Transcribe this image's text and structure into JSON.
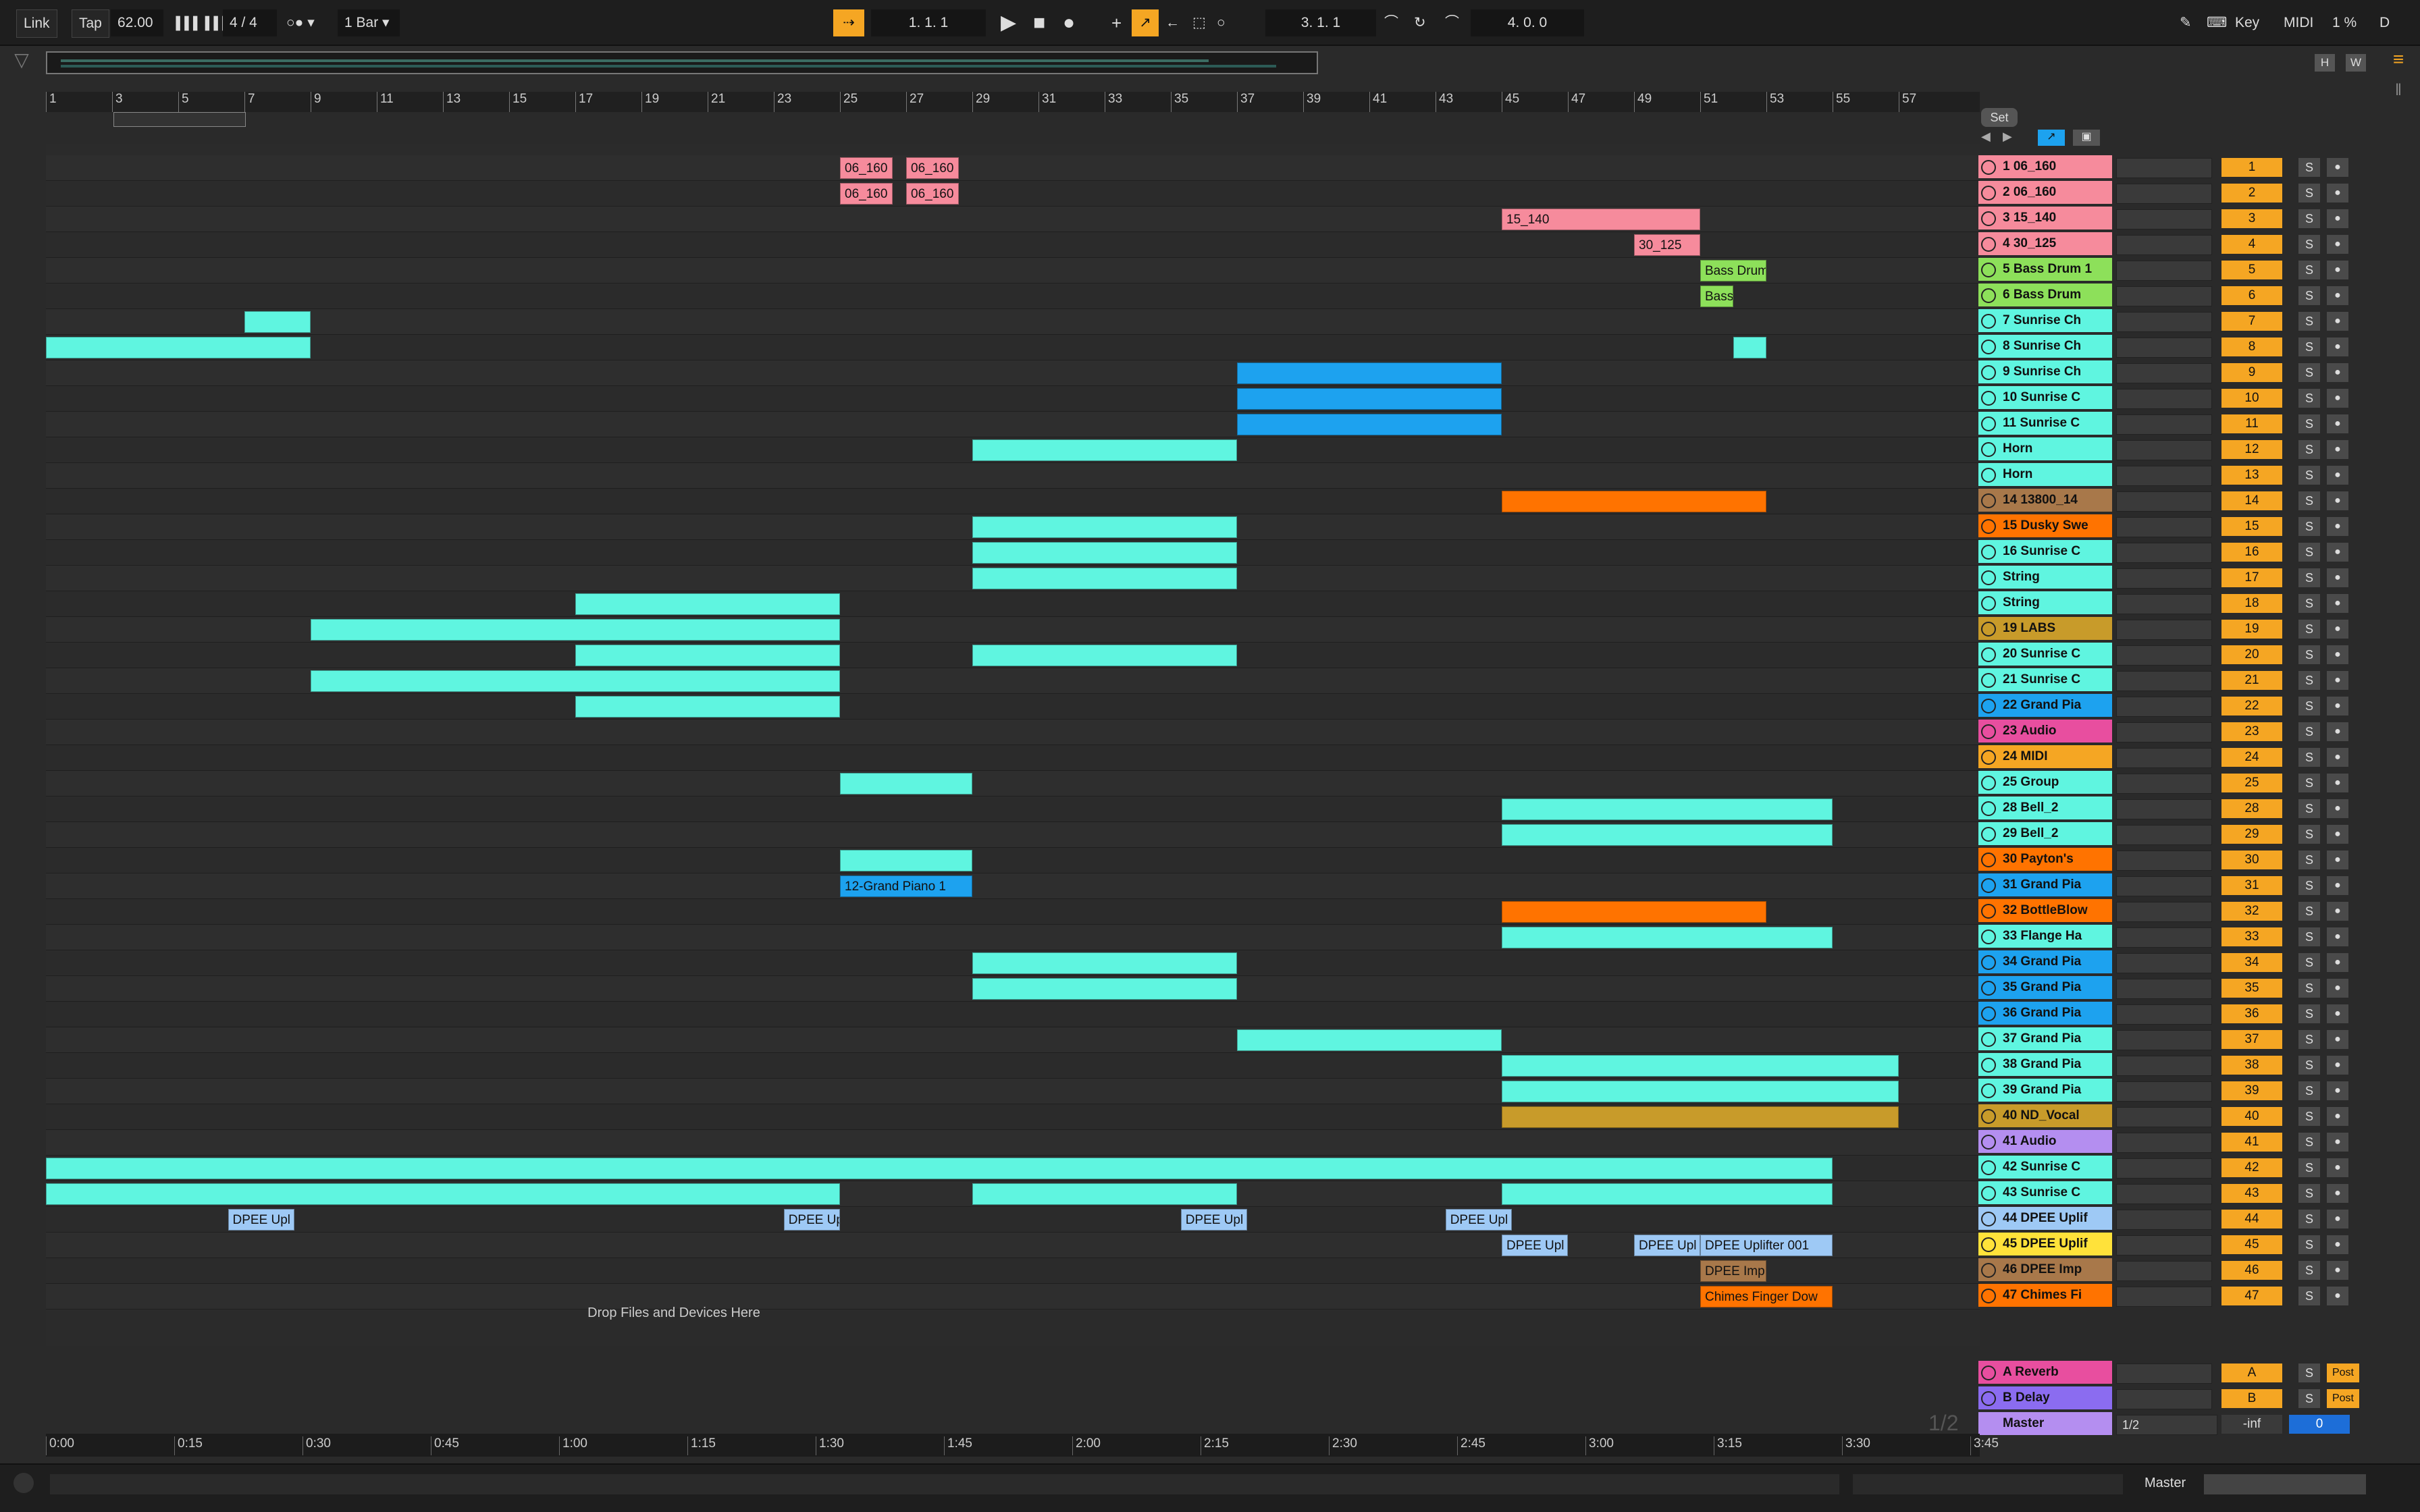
{
  "transport": {
    "link": "Link",
    "tap": "Tap",
    "tempo": "62.00",
    "signature": "4 / 4",
    "quantize": "1 Bar",
    "position": "1.   1.   1",
    "loop_start": "3.   1.   1",
    "loop_length": "4.   0.   0",
    "key": "Key",
    "midi": "MIDI",
    "cpu": "1 %",
    "disk": "D",
    "icons": [
      "metronome-icon",
      "play-icon",
      "stop-icon",
      "record-icon",
      "draw-mode-icon",
      "loop-icon",
      "pencil-icon"
    ]
  },
  "overview": {
    "h_button": "H",
    "w_button": "W"
  },
  "ruler": {
    "bars": [
      "1",
      "3",
      "5",
      "7",
      "9",
      "11",
      "13",
      "15",
      "17",
      "19",
      "21",
      "23",
      "25",
      "27",
      "29",
      "31",
      "33",
      "35",
      "37",
      "39",
      "41",
      "43",
      "45",
      "47",
      "49",
      "51",
      "53",
      "55",
      "57"
    ]
  },
  "set_button": "Set",
  "drop_text": "Drop Files and Devices Here",
  "page_counter": "1/2",
  "colors": {
    "pink": "#f68b9c",
    "green": "#8de05a",
    "cyan": "#5ff5e0",
    "blue": "#1da2ef",
    "orange": "#ff7300",
    "brown": "#a8784a",
    "gold": "#c89b2a",
    "magenta": "#e84e9f",
    "lightblue": "#9ec9f5",
    "yellow": "#ffe23a",
    "purple": "#b48ef0",
    "violet": "#8b6cf0",
    "accent": "#f5a623"
  },
  "tracks": [
    {
      "name": "1 06_160",
      "num": "1",
      "color": "pink"
    },
    {
      "name": "2 06_160",
      "num": "2",
      "color": "pink"
    },
    {
      "name": "3 15_140",
      "num": "3",
      "color": "pink"
    },
    {
      "name": "4 30_125",
      "num": "4",
      "color": "pink"
    },
    {
      "name": "5 Bass Drum 1",
      "num": "5",
      "color": "green"
    },
    {
      "name": "6 Bass Drum",
      "num": "6",
      "color": "green"
    },
    {
      "name": "7 Sunrise Ch",
      "num": "7",
      "color": "cyan"
    },
    {
      "name": "8 Sunrise Ch",
      "num": "8",
      "color": "cyan"
    },
    {
      "name": "9 Sunrise Ch",
      "num": "9",
      "color": "cyan"
    },
    {
      "name": "10 Sunrise C",
      "num": "10",
      "color": "cyan"
    },
    {
      "name": "11 Sunrise C",
      "num": "11",
      "color": "cyan"
    },
    {
      "name": "Horn",
      "num": "12",
      "color": "cyan"
    },
    {
      "name": "Horn",
      "num": "13",
      "color": "cyan"
    },
    {
      "name": "14 13800_14",
      "num": "14",
      "color": "brown"
    },
    {
      "name": "15 Dusky Swe",
      "num": "15",
      "color": "orange"
    },
    {
      "name": "16 Sunrise C",
      "num": "16",
      "color": "cyan"
    },
    {
      "name": "String",
      "num": "17",
      "color": "cyan"
    },
    {
      "name": "String",
      "num": "18",
      "color": "cyan"
    },
    {
      "name": "19 LABS",
      "num": "19",
      "color": "gold"
    },
    {
      "name": "20 Sunrise C",
      "num": "20",
      "color": "cyan"
    },
    {
      "name": "21 Sunrise C",
      "num": "21",
      "color": "cyan"
    },
    {
      "name": "22 Grand Pia",
      "num": "22",
      "color": "blue"
    },
    {
      "name": "23 Audio",
      "num": "23",
      "color": "magenta"
    },
    {
      "name": "24 MIDI",
      "num": "24",
      "color": "accent"
    },
    {
      "name": "25 Group",
      "num": "25",
      "color": "cyan"
    },
    {
      "name": "28 Bell_2",
      "num": "28",
      "color": "cyan"
    },
    {
      "name": "29 Bell_2",
      "num": "29",
      "color": "cyan"
    },
    {
      "name": "30 Payton's",
      "num": "30",
      "color": "orange"
    },
    {
      "name": "31 Grand Pia",
      "num": "31",
      "color": "blue"
    },
    {
      "name": "32 BottleBlow",
      "num": "32",
      "color": "orange"
    },
    {
      "name": "33 Flange Ha",
      "num": "33",
      "color": "cyan"
    },
    {
      "name": "34 Grand Pia",
      "num": "34",
      "color": "blue"
    },
    {
      "name": "35 Grand Pia",
      "num": "35",
      "color": "blue"
    },
    {
      "name": "36 Grand Pia",
      "num": "36",
      "color": "blue"
    },
    {
      "name": "37 Grand Pia",
      "num": "37",
      "color": "cyan"
    },
    {
      "name": "38 Grand Pia",
      "num": "38",
      "color": "cyan"
    },
    {
      "name": "39 Grand Pia",
      "num": "39",
      "color": "cyan"
    },
    {
      "name": "40 ND_Vocal",
      "num": "40",
      "color": "gold"
    },
    {
      "name": "41 Audio",
      "num": "41",
      "color": "purple"
    },
    {
      "name": "42 Sunrise C",
      "num": "42",
      "color": "cyan"
    },
    {
      "name": "43 Sunrise C",
      "num": "43",
      "color": "cyan"
    },
    {
      "name": "44 DPEE Uplif",
      "num": "44",
      "color": "lightblue"
    },
    {
      "name": "45 DPEE Uplif",
      "num": "45",
      "color": "yellow"
    },
    {
      "name": "46 DPEE Imp",
      "num": "46",
      "color": "brown"
    },
    {
      "name": "47 Chimes Fi",
      "num": "47",
      "color": "orange"
    }
  ],
  "returns": [
    {
      "name": "A Reverb",
      "num": "A",
      "color": "magenta",
      "post": "Post"
    },
    {
      "name": "B Delay",
      "num": "B",
      "color": "violet",
      "post": "Post"
    }
  ],
  "master": {
    "name": "Master",
    "routing": "1/2",
    "volume": "-inf",
    "pan": "0"
  },
  "clips": [
    {
      "row": 0,
      "start": 25,
      "len": 1.6,
      "label": "06_160",
      "color": "pink"
    },
    {
      "row": 0,
      "start": 27,
      "len": 1.6,
      "label": "06_160",
      "color": "pink"
    },
    {
      "row": 1,
      "start": 25,
      "len": 1.6,
      "label": "06_160",
      "color": "pink"
    },
    {
      "row": 1,
      "start": 27,
      "len": 1.6,
      "label": "06_160",
      "color": "pink"
    },
    {
      "row": 2,
      "start": 45,
      "len": 6,
      "label": "15_140",
      "color": "pink"
    },
    {
      "row": 3,
      "start": 49,
      "len": 2,
      "label": "30_125",
      "color": "pink"
    },
    {
      "row": 4,
      "start": 51,
      "len": 2,
      "label": "Bass Drum",
      "color": "green"
    },
    {
      "row": 5,
      "start": 51,
      "len": 1,
      "label": "Bass",
      "color": "green"
    },
    {
      "row": 6,
      "start": 7,
      "len": 2,
      "label": "",
      "color": "cyan"
    },
    {
      "row": 7,
      "start": 1,
      "len": 8,
      "label": "",
      "color": "cyan"
    },
    {
      "row": 7,
      "start": 52,
      "len": 1,
      "label": "",
      "color": "cyan"
    },
    {
      "row": 8,
      "start": 37,
      "len": 8,
      "label": "",
      "color": "blue"
    },
    {
      "row": 9,
      "start": 37,
      "len": 8,
      "label": "",
      "color": "blue"
    },
    {
      "row": 10,
      "start": 37,
      "len": 8,
      "label": "",
      "color": "blue"
    },
    {
      "row": 11,
      "start": 29,
      "len": 8,
      "label": "",
      "color": "cyan"
    },
    {
      "row": 13,
      "start": 45,
      "len": 8,
      "label": "",
      "color": "orange"
    },
    {
      "row": 14,
      "start": 29,
      "len": 8,
      "label": "",
      "color": "cyan"
    },
    {
      "row": 15,
      "start": 29,
      "len": 8,
      "label": "",
      "color": "cyan"
    },
    {
      "row": 16,
      "start": 29,
      "len": 8,
      "label": "",
      "color": "cyan"
    },
    {
      "row": 17,
      "start": 17,
      "len": 8,
      "label": "",
      "color": "cyan"
    },
    {
      "row": 18,
      "start": 9,
      "len": 16,
      "label": "",
      "color": "cyan"
    },
    {
      "row": 19,
      "start": 17,
      "len": 8,
      "label": "",
      "color": "cyan"
    },
    {
      "row": 19,
      "start": 29,
      "len": 8,
      "label": "",
      "color": "cyan"
    },
    {
      "row": 20,
      "start": 9,
      "len": 16,
      "label": "",
      "color": "cyan"
    },
    {
      "row": 21,
      "start": 17,
      "len": 8,
      "label": "",
      "color": "cyan"
    },
    {
      "row": 24,
      "start": 25,
      "len": 4,
      "label": "",
      "color": "cyan"
    },
    {
      "row": 25,
      "start": 45,
      "len": 10,
      "label": "",
      "color": "cyan"
    },
    {
      "row": 26,
      "start": 45,
      "len": 10,
      "label": "",
      "color": "cyan"
    },
    {
      "row": 27,
      "start": 25,
      "len": 4,
      "label": "",
      "color": "cyan"
    },
    {
      "row": 28,
      "start": 25,
      "len": 4,
      "label": "12-Grand Piano 1",
      "color": "blue"
    },
    {
      "row": 29,
      "start": 45,
      "len": 8,
      "label": "",
      "color": "orange"
    },
    {
      "row": 30,
      "start": 45,
      "len": 10,
      "label": "",
      "color": "cyan"
    },
    {
      "row": 31,
      "start": 29,
      "len": 8,
      "label": "",
      "color": "cyan"
    },
    {
      "row": 32,
      "start": 29,
      "len": 8,
      "label": "",
      "color": "cyan"
    },
    {
      "row": 34,
      "start": 37,
      "len": 8,
      "label": "",
      "color": "cyan"
    },
    {
      "row": 35,
      "start": 45,
      "len": 12,
      "label": "",
      "color": "cyan"
    },
    {
      "row": 36,
      "start": 45,
      "len": 12,
      "label": "",
      "color": "cyan"
    },
    {
      "row": 37,
      "start": 45,
      "len": 12,
      "label": "",
      "color": "gold"
    },
    {
      "row": 39,
      "start": 1,
      "len": 54,
      "label": "",
      "color": "cyan"
    },
    {
      "row": 40,
      "start": 1,
      "len": 24,
      "label": "",
      "color": "cyan"
    },
    {
      "row": 40,
      "start": 29,
      "len": 8,
      "label": "",
      "color": "cyan"
    },
    {
      "row": 40,
      "start": 45,
      "len": 10,
      "label": "",
      "color": "cyan"
    },
    {
      "row": 41,
      "start": 6.5,
      "len": 2,
      "label": "DPEE Upl",
      "color": "lightblue"
    },
    {
      "row": 41,
      "start": 23.3,
      "len": 1.7,
      "label": "DPEE Up",
      "color": "lightblue"
    },
    {
      "row": 41,
      "start": 35.3,
      "len": 2,
      "label": "DPEE Upl",
      "color": "lightblue"
    },
    {
      "row": 41,
      "start": 43.3,
      "len": 2,
      "label": "DPEE Upl",
      "color": "lightblue"
    },
    {
      "row": 42,
      "start": 45,
      "len": 2,
      "label": "DPEE Upl",
      "color": "lightblue"
    },
    {
      "row": 42,
      "start": 49,
      "len": 2,
      "label": "DPEE Upl",
      "color": "lightblue"
    },
    {
      "row": 42,
      "start": 51,
      "len": 4,
      "label": "DPEE Uplifter 001",
      "color": "lightblue"
    },
    {
      "row": 43,
      "start": 51,
      "len": 2,
      "label": "DPEE Imp",
      "color": "brown"
    },
    {
      "row": 44,
      "start": 51,
      "len": 4,
      "label": "Chimes Finger Dow",
      "color": "orange"
    }
  ],
  "time_ruler": [
    "0:00",
    "0:15",
    "0:30",
    "0:45",
    "1:00",
    "1:15",
    "1:30",
    "1:45",
    "2:00",
    "2:15",
    "2:30",
    "2:45",
    "3:00",
    "3:15",
    "3:30",
    "3:45"
  ],
  "bottom": {
    "master_label": "Master"
  }
}
